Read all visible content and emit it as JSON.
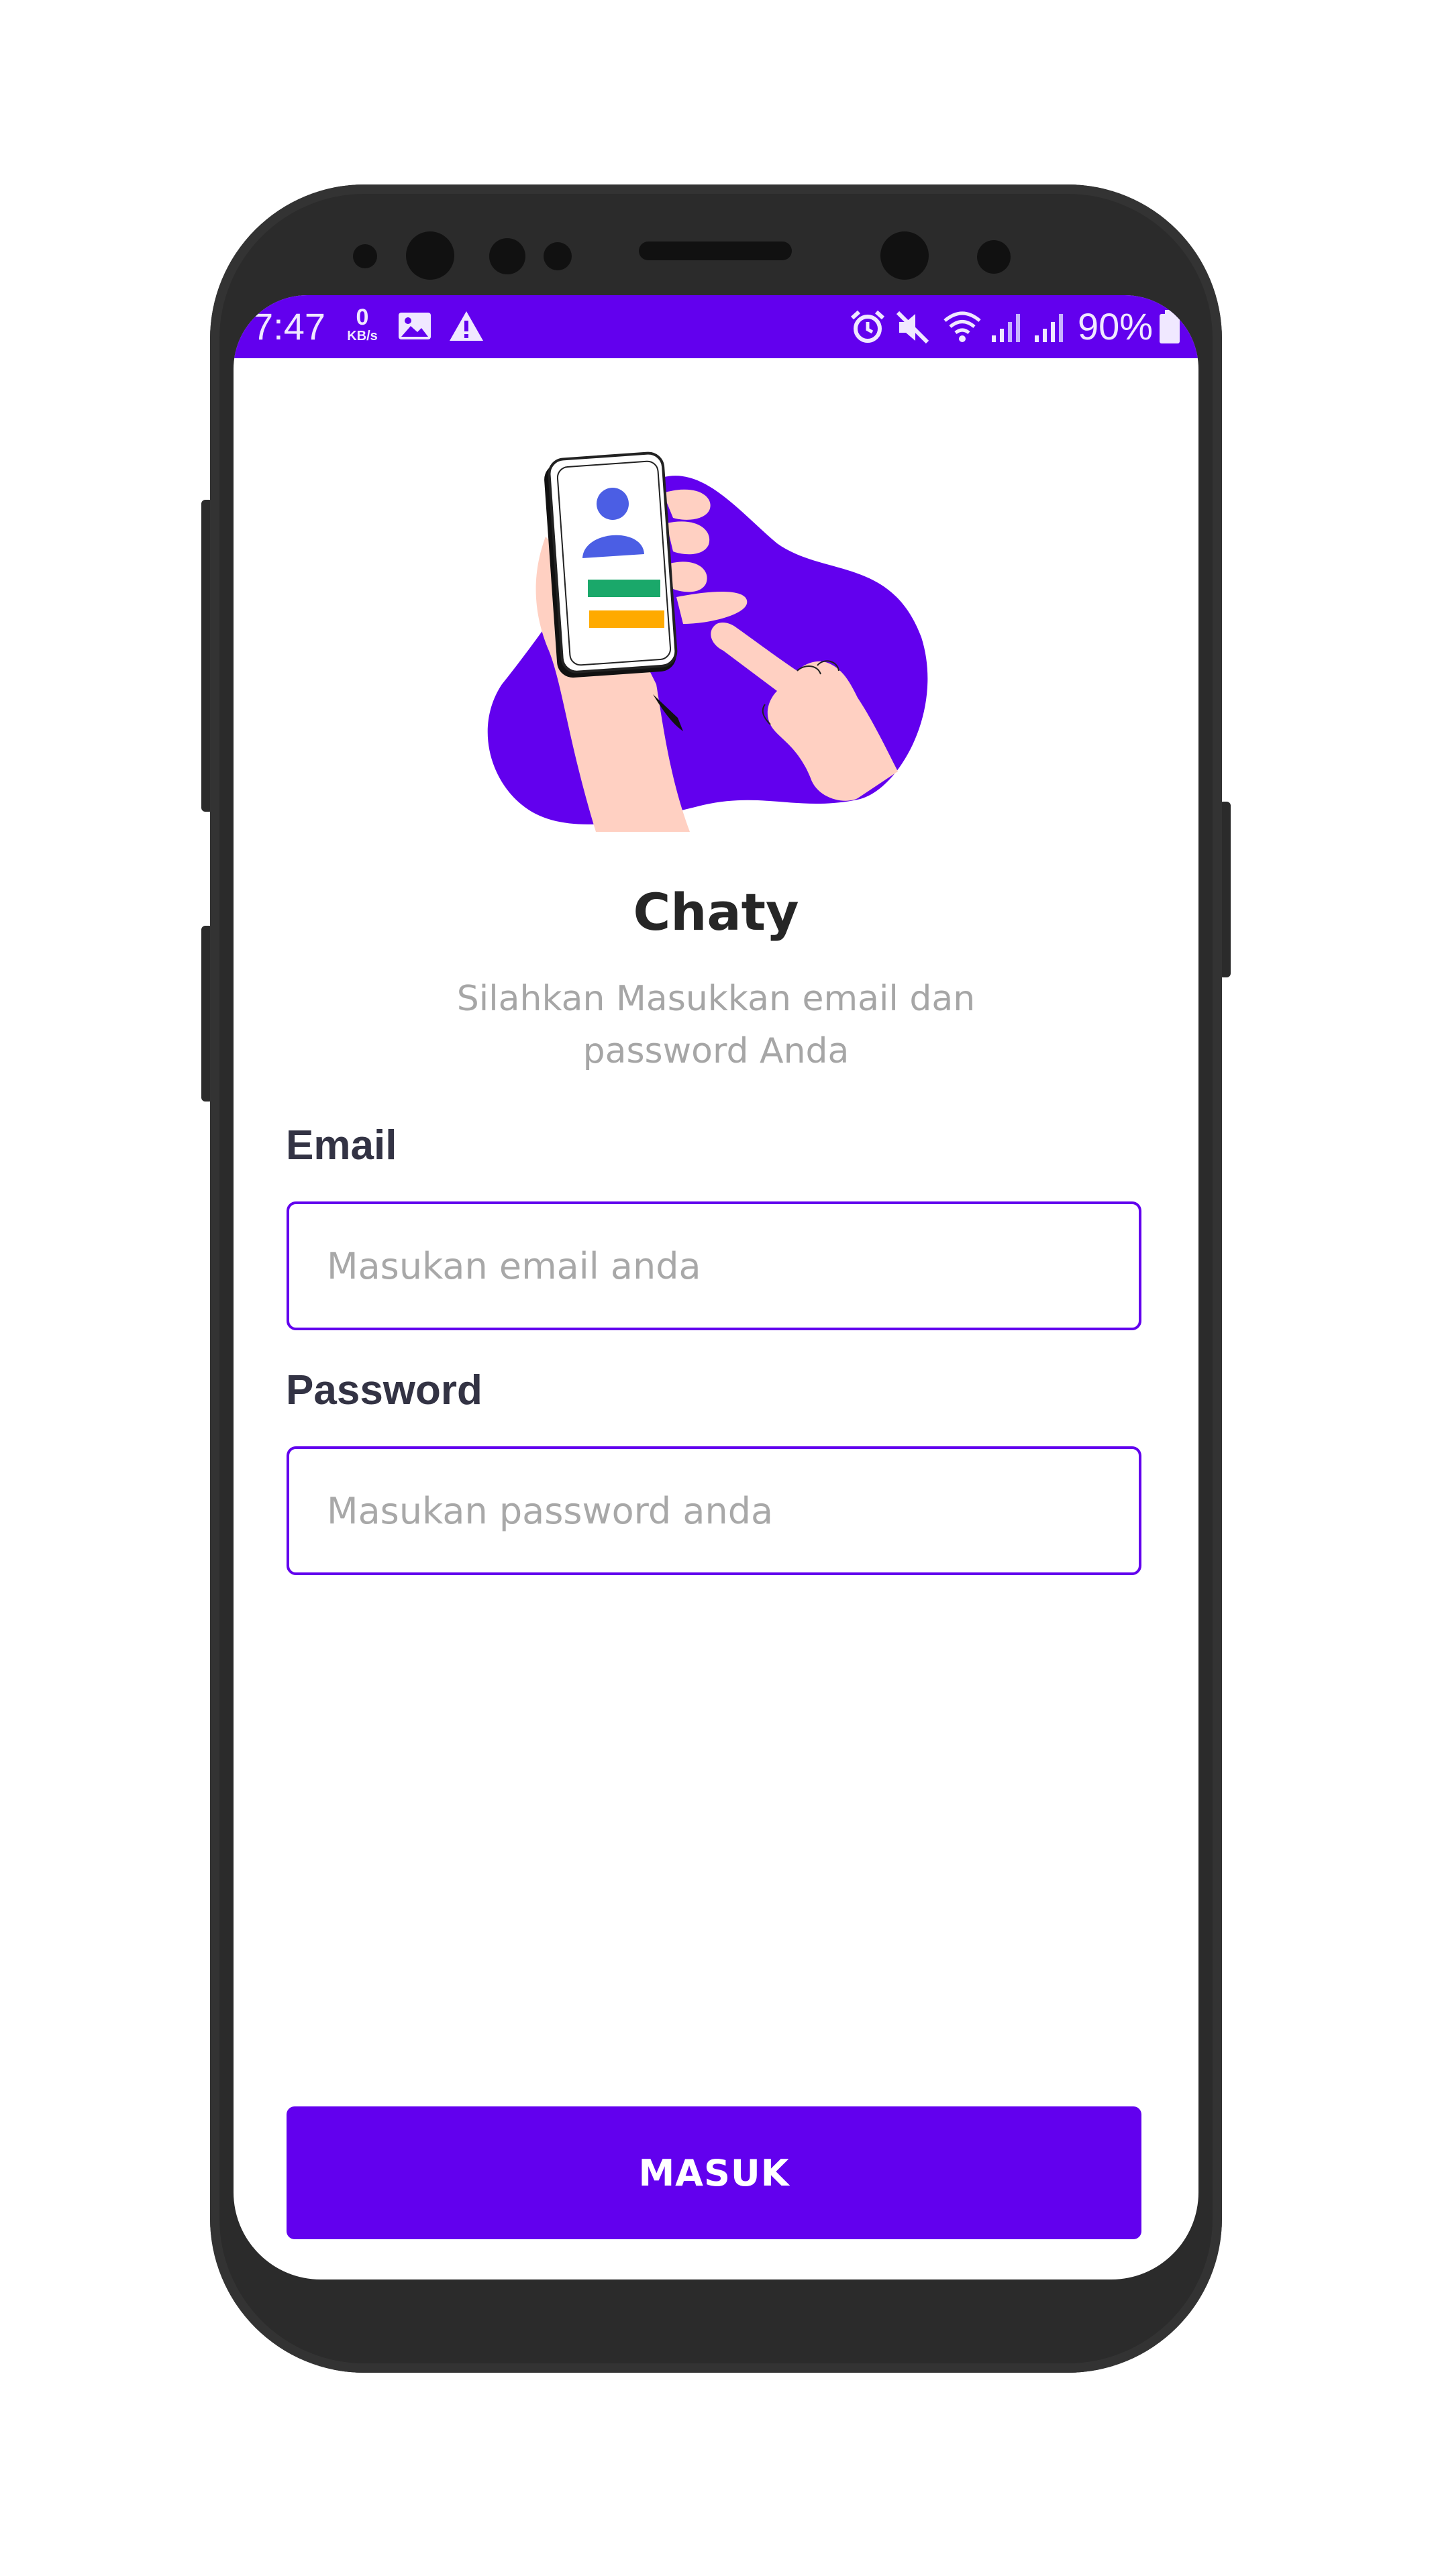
{
  "status_bar": {
    "time": "7:47",
    "data_speed_value": "0",
    "data_speed_unit": "KB/s",
    "battery_percent": "90%",
    "icons": [
      "image-icon",
      "warning-icon",
      "alarm-icon",
      "mute-icon",
      "wifi-icon",
      "signal-icon",
      "signal-icon",
      "battery-icon"
    ]
  },
  "app": {
    "title": "Chaty",
    "subtitle": "Silahkan Masukkan email dan password Anda"
  },
  "form": {
    "email_label": "Email",
    "email_placeholder": "Masukan email anda",
    "email_value": "",
    "password_label": "Password",
    "password_placeholder": "Masukan password anda",
    "password_value": ""
  },
  "actions": {
    "login_label": "MASUK"
  },
  "colors": {
    "primary": "#6200ee",
    "label_text": "#333344",
    "placeholder": "#a8a8a8",
    "skin": "#ffd0c2",
    "accent_green": "#1aa86a",
    "accent_orange": "#ffaa00",
    "avatar_blue": "#4b5ee4"
  }
}
